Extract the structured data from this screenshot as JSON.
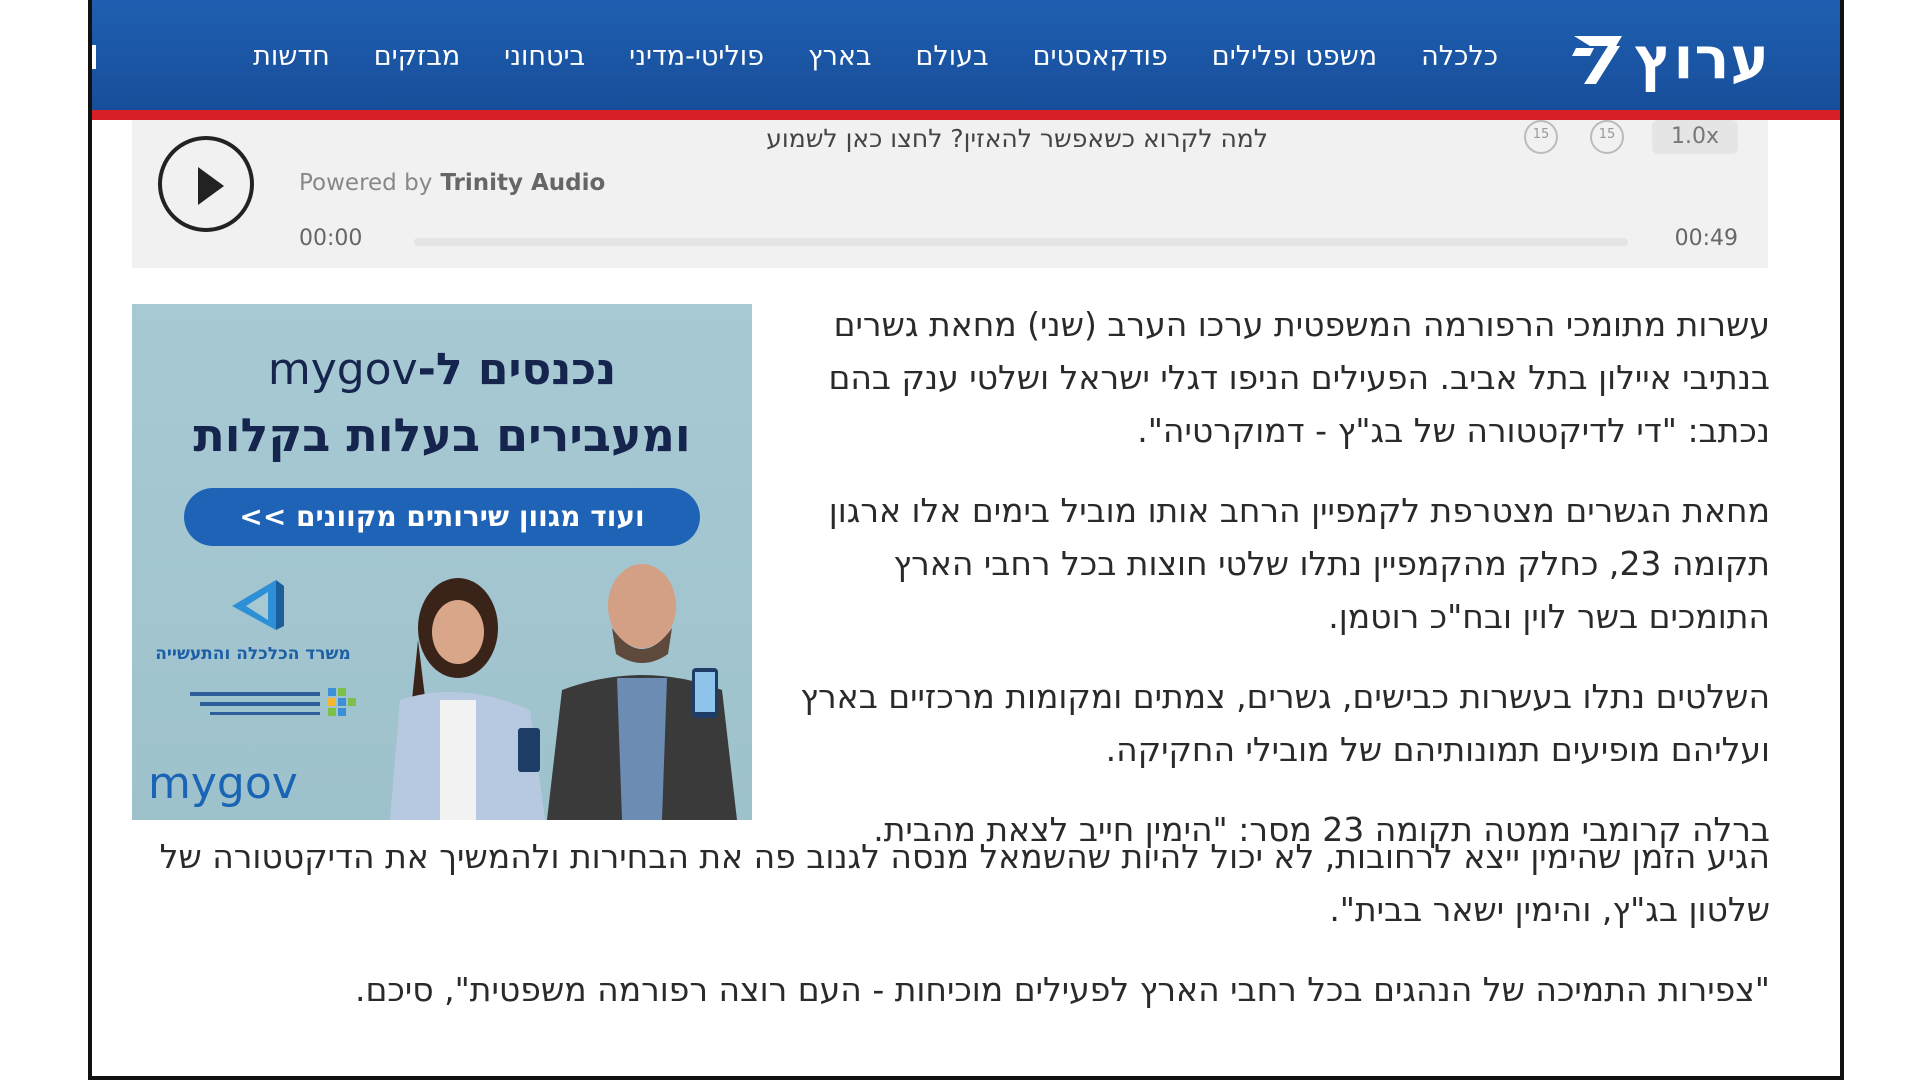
{
  "header": {
    "logo_text": "ערוץ",
    "nav": [
      "חדשות",
      "מבזקים",
      "ביטחוני",
      "פוליטי-מדיני",
      "בארץ",
      "בעולם",
      "פודקאסטים",
      "משפט ופלילים",
      "כלכלה"
    ]
  },
  "audio_player": {
    "cta": "למה לקרוא כשאפשר להאזין? לחצו כאן לשמוע",
    "powered_by": "Powered by",
    "provider": "Trinity Audio",
    "time_start": "00:00",
    "time_end": "00:49",
    "speed": "1.0x",
    "progress": 0,
    "icons": [
      "play-icon",
      "rewind-icon",
      "forward-icon"
    ]
  },
  "ad": {
    "headline_1": "נכנסים ל-",
    "headline_brand": "mygov",
    "headline_2": "ומעבירים בעלות בקלות",
    "pill": "ועוד מגוון שירותים מקוונים >>",
    "ministry": "משרד הכלכלה והתעשייה",
    "brand_footer": "mygov"
  },
  "article": {
    "paragraphs": [
      "עשרות מתומכי הרפורמה המשפטית ערכו הערב (שני) מחאת גשרים בנתיבי איילון בתל אביב. הפעילים הניפו דגלי ישראל ושלטי ענק בהם נכתב: \"די לדיקטטורה של בג\"ץ - דמוקרטיה\".",
      "מחאת הגשרים מצטרפת לקמפיין הרחב אותו מוביל בימים אלו ארגון תקומה 23, כחלק מהקמפיין נתלו שלטי חוצות בכל רחבי הארץ התומכים בשר לוין ובח\"כ רוטמן.",
      "השלטים נתלו בעשרות כבישים, גשרים, צמתים ומקומות מרכזיים בארץ ועליהם מופיעים תמונותיהם של מובילי החקיקה.",
      "ברלה קרומבי ממטה תקומה 23 מסר: \"הימין חייב לצאת מהבית."
    ],
    "wide_paragraphs": [
      "הגיע הזמן שהימין ייצא לרחובות, לא יכול להיות שהשמאל מנסה לגנוב פה את הבחירות ולהמשיך את הדיקטטורה של שלטון בג\"ץ, והימין ישאר בבית\".",
      "\"צפירות התמיכה של הנהגים בכל רחבי הארץ לפעילים מוכיחות - העם רוצה רפורמה משפטית\", סיכם."
    ]
  },
  "colors": {
    "header_blue": "#1f5fb1",
    "header_red_stripe": "#d61f26",
    "ad_background": "#a7c9d3",
    "ad_navy": "#15254d",
    "ad_blue": "#1f63b6"
  }
}
